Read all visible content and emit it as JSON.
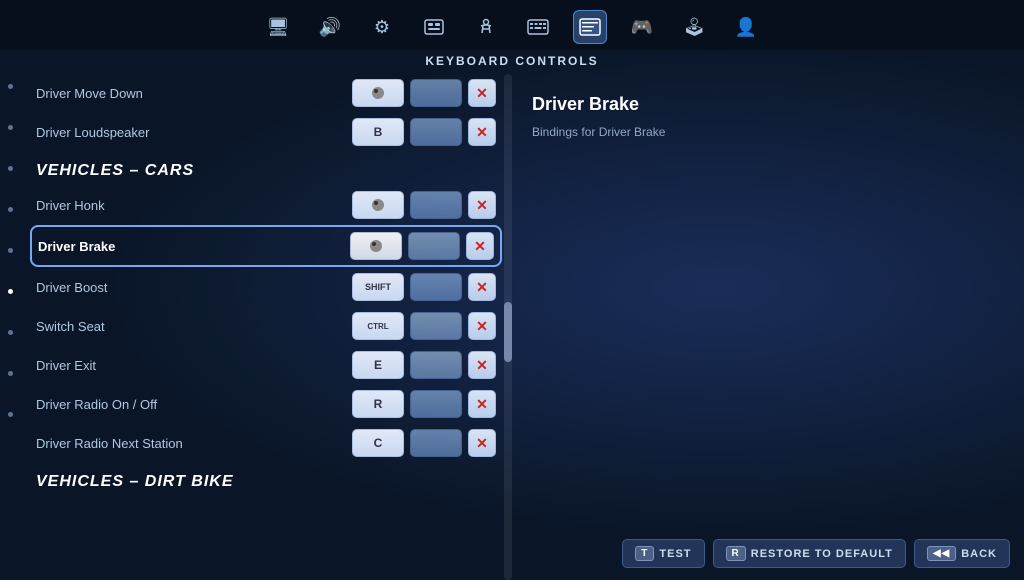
{
  "page": {
    "title": "KEYBOARD CONTROLS"
  },
  "nav": {
    "icons": [
      {
        "name": "display-icon",
        "symbol": "🖥",
        "active": false
      },
      {
        "name": "audio-icon",
        "symbol": "🔊",
        "active": false
      },
      {
        "name": "settings-icon",
        "symbol": "⚙",
        "active": false
      },
      {
        "name": "hud-icon",
        "symbol": "🖧",
        "active": false
      },
      {
        "name": "accessibility-icon",
        "symbol": "♿",
        "active": false
      },
      {
        "name": "keyboard-icon",
        "symbol": "⌨",
        "active": false
      },
      {
        "name": "controls-icon",
        "symbol": "▦",
        "active": true
      },
      {
        "name": "gamepad-icon",
        "symbol": "🎮",
        "active": false
      },
      {
        "name": "controller2-icon",
        "symbol": "🕹",
        "active": false
      },
      {
        "name": "profile-icon",
        "symbol": "👤",
        "active": false
      }
    ]
  },
  "sidebar_dots": [
    {
      "active": false
    },
    {
      "active": false
    },
    {
      "active": false
    },
    {
      "active": false
    },
    {
      "active": false
    },
    {
      "active": true
    },
    {
      "active": false
    },
    {
      "active": false
    },
    {
      "active": false
    }
  ],
  "sections": [
    {
      "type": "rows",
      "rows": [
        {
          "id": "driver-move-down",
          "label": "Driver Move Down",
          "key1": "🖱",
          "key1_type": "filled",
          "key2_type": "empty",
          "selected": false
        },
        {
          "id": "driver-loudspeaker",
          "label": "Driver Loudspeaker",
          "key1": "B",
          "key1_type": "filled",
          "key2_type": "empty",
          "selected": false
        }
      ]
    },
    {
      "type": "header",
      "text": "VEHICLES – CARS"
    },
    {
      "type": "rows",
      "rows": [
        {
          "id": "driver-honk",
          "label": "Driver Honk",
          "key1": "🖱",
          "key1_type": "filled",
          "key2_type": "empty",
          "selected": false
        },
        {
          "id": "driver-brake",
          "label": "Driver Brake",
          "key1": "🖱",
          "key1_type": "filled",
          "key2_type": "empty",
          "selected": true
        },
        {
          "id": "driver-boost",
          "label": "Driver Boost",
          "key1": "SHIFT",
          "key1_type": "filled",
          "key2_type": "empty",
          "selected": false
        },
        {
          "id": "switch-seat",
          "label": "Switch Seat",
          "key1": "CTRL",
          "key1_type": "filled",
          "key2_type": "empty",
          "selected": false
        },
        {
          "id": "driver-exit",
          "label": "Driver Exit",
          "key1": "E",
          "key1_type": "filled",
          "key2_type": "empty",
          "selected": false
        },
        {
          "id": "driver-radio-on-off",
          "label": "Driver Radio On / Off",
          "key1": "R",
          "key1_type": "filled",
          "key2_type": "empty",
          "selected": false
        },
        {
          "id": "driver-radio-next-station",
          "label": "Driver Radio Next Station",
          "key1": "C",
          "key1_type": "filled",
          "key2_type": "empty",
          "selected": false
        }
      ]
    },
    {
      "type": "header",
      "text": "VEHICLES – DIRT BIKE"
    }
  ],
  "info_panel": {
    "title": "Driver Brake",
    "description": "Bindings for Driver Brake"
  },
  "bottom_bar": {
    "test_key": "T",
    "test_label": "TEST",
    "restore_key": "R",
    "restore_label": "RESTORE TO DEFAULT",
    "back_key": "◀◀",
    "back_label": "BACK"
  }
}
